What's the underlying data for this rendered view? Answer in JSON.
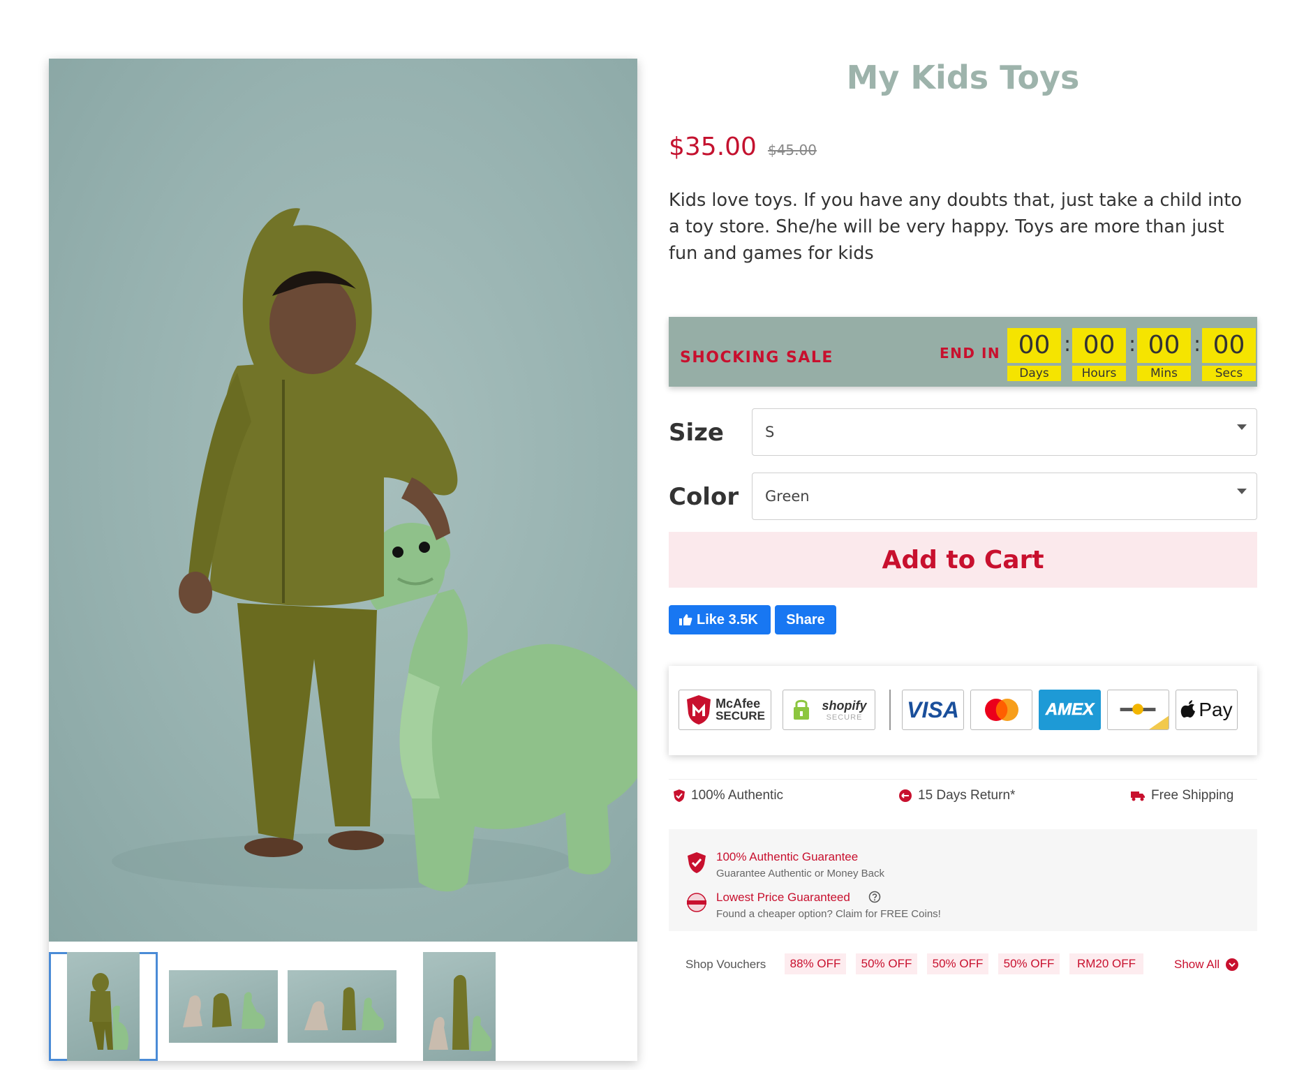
{
  "product": {
    "title": "My Kids Toys",
    "price": "$35.00",
    "compare_price": "$45.00",
    "description": "Kids love toys. If you have any doubts that, just take a child into a toy store. She/he will be very happy. Toys are more than just fun and games for kids"
  },
  "sale": {
    "label": "SHOCKING SALE",
    "end_label": "END IN",
    "countdown": [
      {
        "value": "00",
        "unit": "Days"
      },
      {
        "value": "00",
        "unit": "Hours"
      },
      {
        "value": "00",
        "unit": "Mins"
      },
      {
        "value": "00",
        "unit": "Secs"
      }
    ],
    "separator": ":"
  },
  "options": {
    "size": {
      "label": "Size",
      "value": "S"
    },
    "color": {
      "label": "Color",
      "value": "Green"
    }
  },
  "cart": {
    "label": "Add to Cart"
  },
  "social": {
    "like_label": "Like 3.5K",
    "share_label": "Share"
  },
  "badges": {
    "mcafee_line1": "McAfee",
    "mcafee_line2": "SECURE",
    "shopify_line1": "shopify",
    "shopify_line2": "SECURE",
    "visa": "VISA",
    "amex": "AMEX",
    "applepay": "Pay"
  },
  "trust": {
    "authentic": "100% Authentic",
    "returns": "15 Days Return*",
    "shipping": "Free Shipping"
  },
  "guarantee": {
    "authentic_title": "100% Authentic Guarantee",
    "authentic_sub": "Guarantee Authentic or Money Back",
    "price_title": "Lowest Price Guaranteed",
    "price_sub": "Found a cheaper option? Claim for FREE Coins!"
  },
  "vouchers": {
    "label": "Shop Vouchers",
    "tags": [
      "88% OFF",
      "50% OFF",
      "50% OFF",
      "50% OFF",
      "RM20 OFF"
    ],
    "show_all": "Show All"
  },
  "colors": {
    "accent_red": "#c8102e",
    "price_red": "#c4122f",
    "title_green": "#9db3ab",
    "sale_bg": "#96aea6",
    "countdown_yellow": "#f5e400",
    "cart_bg": "#fbe9ec",
    "facebook_blue": "#1877f2",
    "thumb_active": "#4a8bd6"
  },
  "icons": {
    "authentic": "shield-check-icon",
    "returns": "return-icon",
    "shipping": "truck-icon",
    "like": "thumbs-up-icon",
    "show_all": "chevron-down-circle-icon",
    "help": "question-circle-icon"
  }
}
